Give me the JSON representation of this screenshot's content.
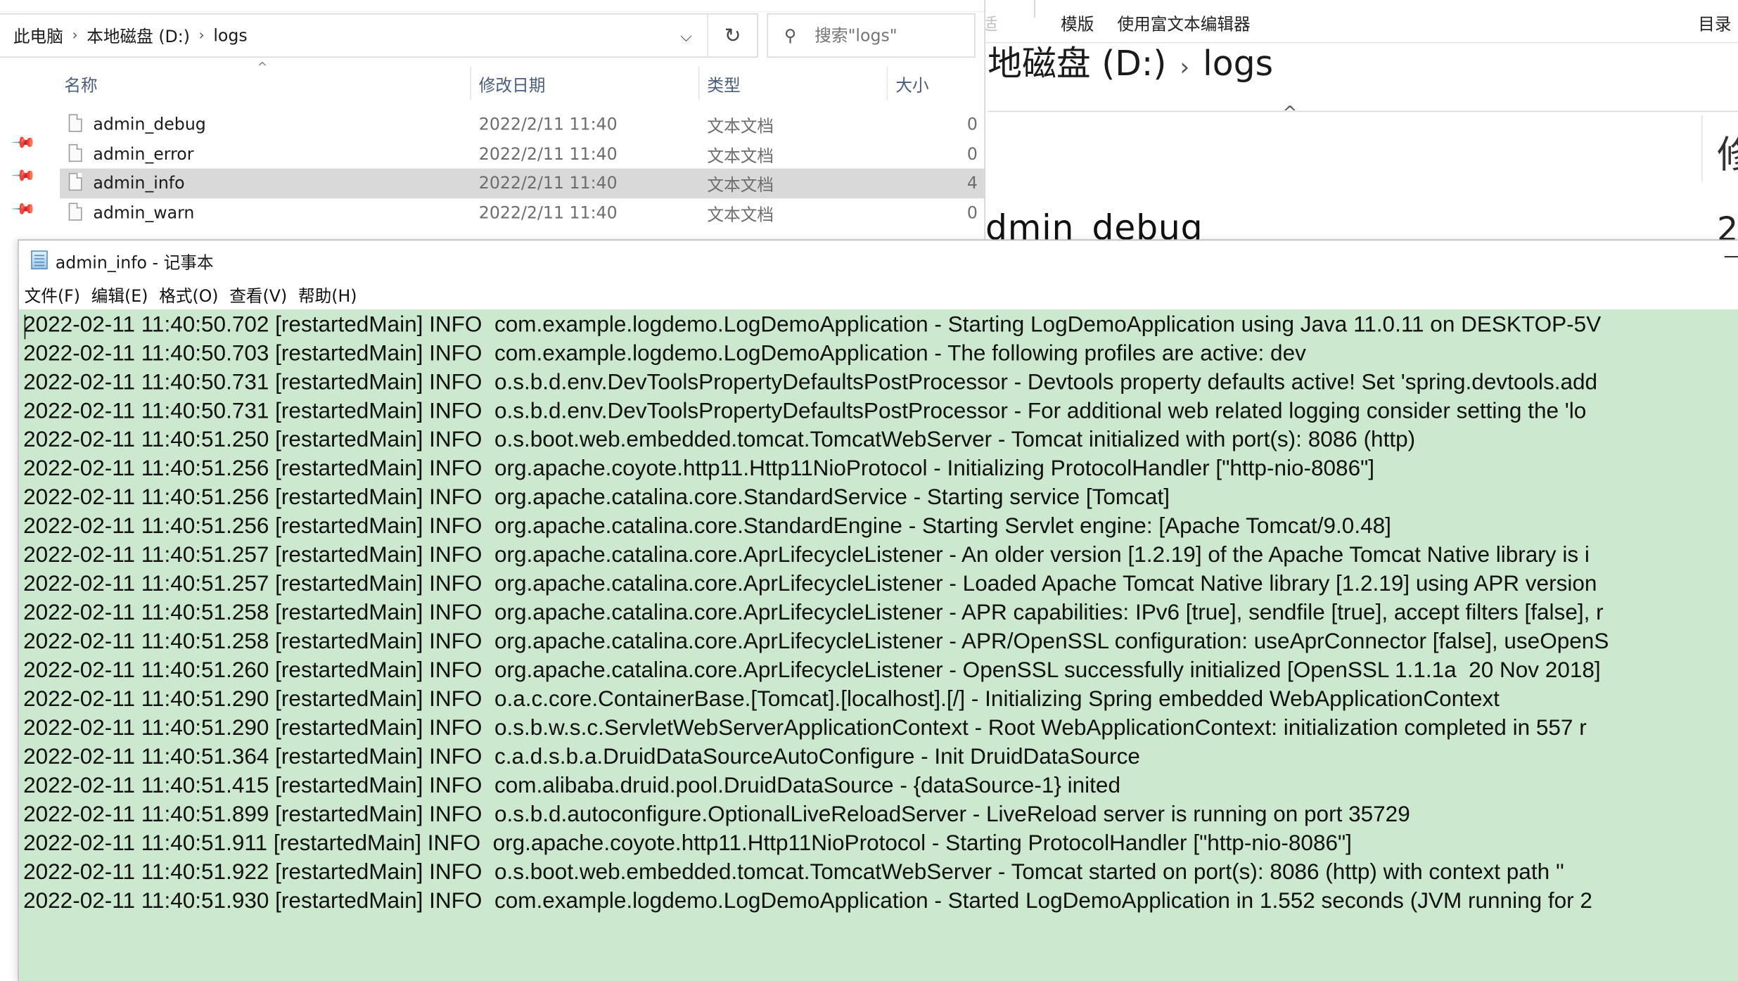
{
  "explorer": {
    "breadcrumb": [
      "此电脑",
      "本地磁盘 (D:)",
      "logs"
    ],
    "search_placeholder": "搜索\"logs\"",
    "columns": {
      "name": "名称",
      "date": "修改日期",
      "type": "类型",
      "size": "大小"
    },
    "files": [
      {
        "name": "admin_debug",
        "date": "2022/2/11 11:40",
        "type": "文本文档",
        "size": "0",
        "selected": false
      },
      {
        "name": "admin_error",
        "date": "2022/2/11 11:40",
        "type": "文本文档",
        "size": "0",
        "selected": false
      },
      {
        "name": "admin_info",
        "date": "2022/2/11 11:40",
        "type": "文本文档",
        "size": "4",
        "selected": true
      },
      {
        "name": "admin_warn",
        "date": "2022/2/11 11:40",
        "type": "文本文档",
        "size": "0",
        "selected": false
      }
    ]
  },
  "bg_window": {
    "ribbon_faded": "适",
    "ribbon_template": "模版",
    "ribbon_rich_editor": "使用富文本编辑器",
    "ribbon_toc": "目录",
    "crumb_drive": "地磁盘 (D:)",
    "crumb_folder": "logs",
    "col_header_partial": "修",
    "file_partial": "dmin_debug",
    "partial_digit": "2"
  },
  "notepad": {
    "title": "admin_info - 记事本",
    "menu": [
      "文件(F)",
      "编辑(E)",
      "格式(O)",
      "查看(V)",
      "帮助(H)"
    ],
    "lines": [
      "2022-02-11 11:40:50.702 [restartedMain] INFO  com.example.logdemo.LogDemoApplication - Starting LogDemoApplication using Java 11.0.11 on DESKTOP-5V",
      "2022-02-11 11:40:50.703 [restartedMain] INFO  com.example.logdemo.LogDemoApplication - The following profiles are active: dev",
      "2022-02-11 11:40:50.731 [restartedMain] INFO  o.s.b.d.env.DevToolsPropertyDefaultsPostProcessor - Devtools property defaults active! Set 'spring.devtools.add",
      "2022-02-11 11:40:50.731 [restartedMain] INFO  o.s.b.d.env.DevToolsPropertyDefaultsPostProcessor - For additional web related logging consider setting the 'lo",
      "2022-02-11 11:40:51.250 [restartedMain] INFO  o.s.boot.web.embedded.tomcat.TomcatWebServer - Tomcat initialized with port(s): 8086 (http)",
      "2022-02-11 11:40:51.256 [restartedMain] INFO  org.apache.coyote.http11.Http11NioProtocol - Initializing ProtocolHandler [\"http-nio-8086\"]",
      "2022-02-11 11:40:51.256 [restartedMain] INFO  org.apache.catalina.core.StandardService - Starting service [Tomcat]",
      "2022-02-11 11:40:51.256 [restartedMain] INFO  org.apache.catalina.core.StandardEngine - Starting Servlet engine: [Apache Tomcat/9.0.48]",
      "2022-02-11 11:40:51.257 [restartedMain] INFO  org.apache.catalina.core.AprLifecycleListener - An older version [1.2.19] of the Apache Tomcat Native library is i",
      "2022-02-11 11:40:51.257 [restartedMain] INFO  org.apache.catalina.core.AprLifecycleListener - Loaded Apache Tomcat Native library [1.2.19] using APR version",
      "2022-02-11 11:40:51.258 [restartedMain] INFO  org.apache.catalina.core.AprLifecycleListener - APR capabilities: IPv6 [true], sendfile [true], accept filters [false], r",
      "2022-02-11 11:40:51.258 [restartedMain] INFO  org.apache.catalina.core.AprLifecycleListener - APR/OpenSSL configuration: useAprConnector [false], useOpenS",
      "2022-02-11 11:40:51.260 [restartedMain] INFO  org.apache.catalina.core.AprLifecycleListener - OpenSSL successfully initialized [OpenSSL 1.1.1a  20 Nov 2018]",
      "2022-02-11 11:40:51.290 [restartedMain] INFO  o.a.c.core.ContainerBase.[Tomcat].[localhost].[/] - Initializing Spring embedded WebApplicationContext",
      "2022-02-11 11:40:51.290 [restartedMain] INFO  o.s.b.w.s.c.ServletWebServerApplicationContext - Root WebApplicationContext: initialization completed in 557 r",
      "2022-02-11 11:40:51.364 [restartedMain] INFO  c.a.d.s.b.a.DruidDataSourceAutoConfigure - Init DruidDataSource",
      "2022-02-11 11:40:51.415 [restartedMain] INFO  com.alibaba.druid.pool.DruidDataSource - {dataSource-1} inited",
      "2022-02-11 11:40:51.899 [restartedMain] INFO  o.s.b.d.autoconfigure.OptionalLiveReloadServer - LiveReload server is running on port 35729",
      "2022-02-11 11:40:51.911 [restartedMain] INFO  org.apache.coyote.http11.Http11NioProtocol - Starting ProtocolHandler [\"http-nio-8086\"]",
      "2022-02-11 11:40:51.922 [restartedMain] INFO  o.s.boot.web.embedded.tomcat.TomcatWebServer - Tomcat started on port(s): 8086 (http) with context path ''",
      "2022-02-11 11:40:51.930 [restartedMain] INFO  com.example.logdemo.LogDemoApplication - Started LogDemoApplication in 1.552 seconds (JVM running for 2"
    ],
    "edit_background": "#cce8cf"
  },
  "icons": {
    "refresh": "refresh-icon",
    "dropdown": "chevron-down-icon",
    "search": "search-icon",
    "pin": "pin-icon",
    "file": "text-file-icon",
    "notepad": "notepad-icon"
  }
}
